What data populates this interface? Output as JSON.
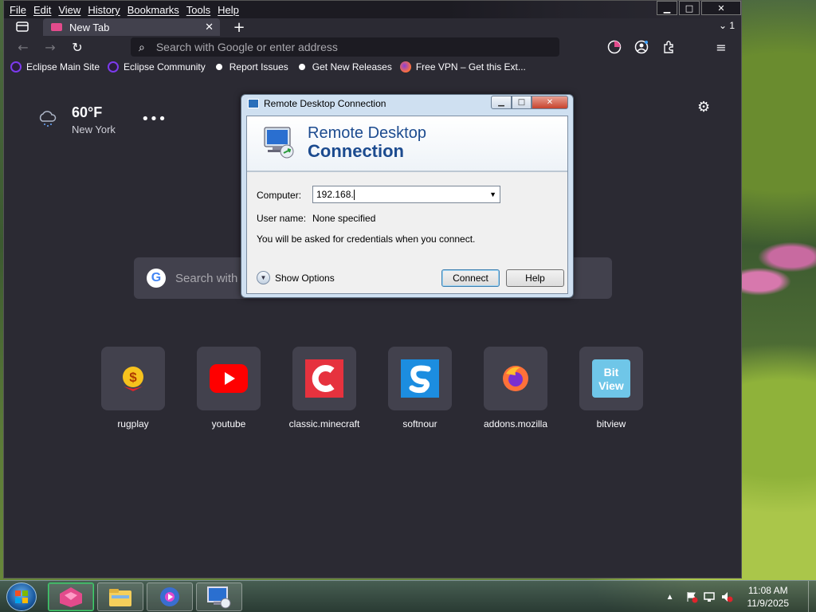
{
  "menubar": {
    "items": [
      "File",
      "Edit",
      "View",
      "History",
      "Bookmarks",
      "Tools",
      "Help"
    ]
  },
  "window_controls": {
    "minimize": "▁",
    "maximize": "□",
    "close": "✕"
  },
  "tabs": [
    {
      "label": "New Tab",
      "close": "✕"
    }
  ],
  "tabbar": {
    "new_tab": "+",
    "list_all": "⌄ 1"
  },
  "urlbar": {
    "placeholder": "Search with Google or enter address"
  },
  "bookmarks": [
    {
      "label": "Eclipse Main Site",
      "icon": "eclipse-icon",
      "color": "#2a1e3a"
    },
    {
      "label": "Eclipse Community",
      "icon": "eclipse-icon",
      "color": "#2a1e3a"
    },
    {
      "label": "Report Issues",
      "icon": "github-icon",
      "color": "#ffffff"
    },
    {
      "label": "Get New Releases",
      "icon": "github-icon",
      "color": "#ffffff"
    },
    {
      "label": "Free VPN – Get this Ext...",
      "icon": "firefox-icon",
      "color": "#ff7139"
    }
  ],
  "weather": {
    "temp": "60°F",
    "city": "New York",
    "more": "•••"
  },
  "search": {
    "placeholder": "Search with"
  },
  "top_sites": [
    {
      "label": "rugplay",
      "icon": "dollar-coin-icon"
    },
    {
      "label": "youtube",
      "icon": "youtube-icon"
    },
    {
      "label": "classic.minecraft",
      "icon": "minecraft-c-icon"
    },
    {
      "label": "softnour",
      "icon": "softnour-s-icon"
    },
    {
      "label": "addons.mozilla",
      "icon": "firefox-icon"
    },
    {
      "label": "bitview",
      "icon": "bitview-icon"
    }
  ],
  "dialog": {
    "title": "Remote Desktop Connection",
    "banner_line1": "Remote Desktop",
    "banner_line2": "Connection",
    "computer_label": "Computer:",
    "computer_value": "192.168.",
    "username_label": "User name:",
    "username_value": "None specified",
    "info": "You will be asked for credentials when you connect.",
    "show_options": "Show Options",
    "connect": "Connect",
    "help": "Help"
  },
  "taskbar": {
    "time": "11:08 AM",
    "date": "11/9/2025",
    "tray_expand": "▲"
  },
  "colors": {
    "browser_bg": "#2b2a33",
    "tile_bg": "#42414d",
    "dialog_title_color": "#1c4b8f",
    "accent_pink": "#e34b8c"
  }
}
